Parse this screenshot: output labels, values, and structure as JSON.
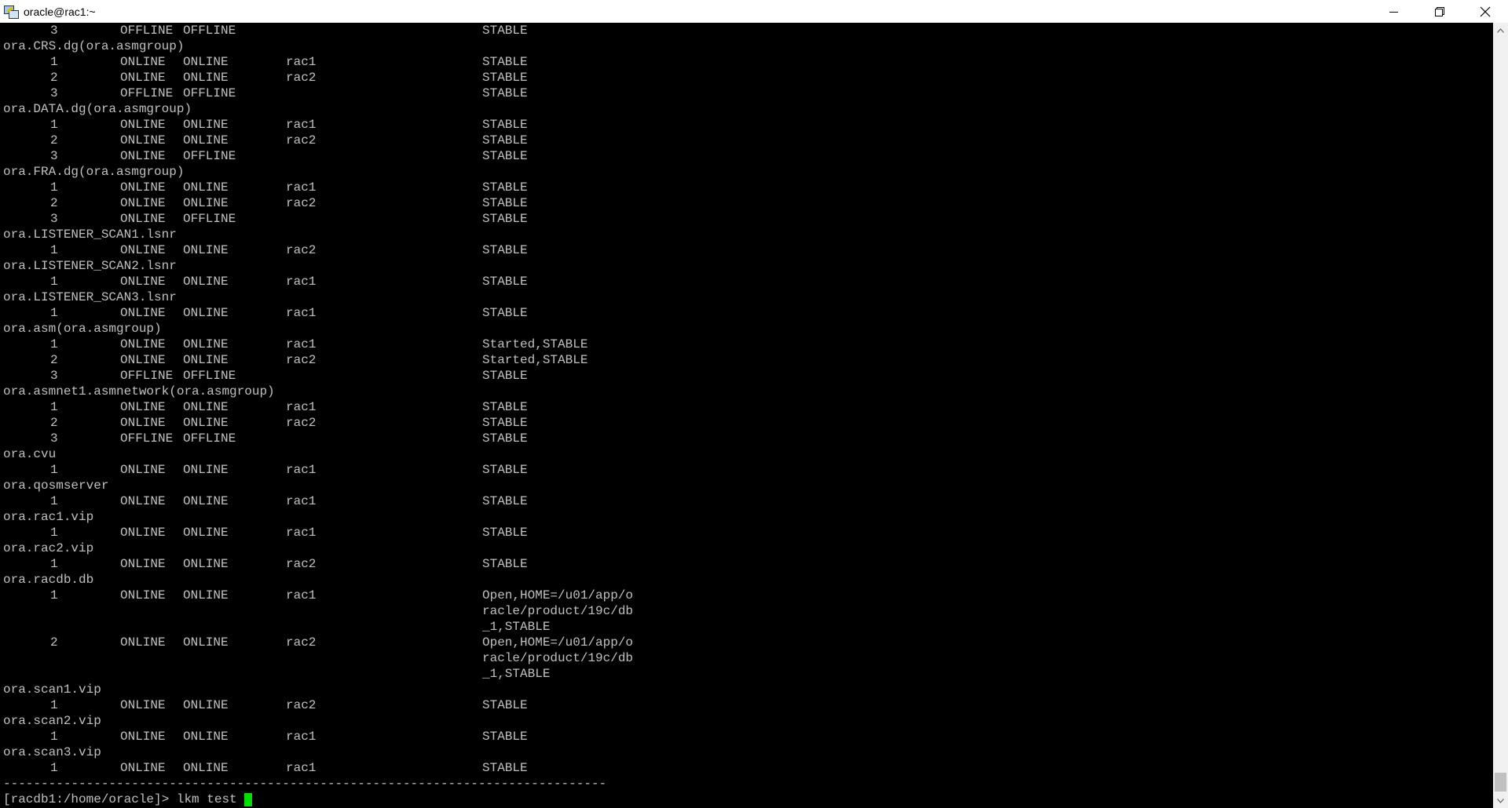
{
  "window": {
    "title": "oracle@rac1:~",
    "controls": [
      "minimize",
      "restore",
      "close"
    ]
  },
  "terminal": {
    "lines": [
      {
        "num": "3",
        "target": "OFFLINE",
        "state": "OFFLINE",
        "server": "",
        "details": "STABLE"
      },
      {
        "name": "ora.CRS.dg(ora.asmgroup)"
      },
      {
        "num": "1",
        "target": "ONLINE",
        "state": "ONLINE",
        "server": "rac1",
        "details": "STABLE"
      },
      {
        "num": "2",
        "target": "ONLINE",
        "state": "ONLINE",
        "server": "rac2",
        "details": "STABLE"
      },
      {
        "num": "3",
        "target": "OFFLINE",
        "state": "OFFLINE",
        "server": "",
        "details": "STABLE"
      },
      {
        "name": "ora.DATA.dg(ora.asmgroup)"
      },
      {
        "num": "1",
        "target": "ONLINE",
        "state": "ONLINE",
        "server": "rac1",
        "details": "STABLE"
      },
      {
        "num": "2",
        "target": "ONLINE",
        "state": "ONLINE",
        "server": "rac2",
        "details": "STABLE"
      },
      {
        "num": "3",
        "target": "ONLINE",
        "state": "OFFLINE",
        "server": "",
        "details": "STABLE"
      },
      {
        "name": "ora.FRA.dg(ora.asmgroup)"
      },
      {
        "num": "1",
        "target": "ONLINE",
        "state": "ONLINE",
        "server": "rac1",
        "details": "STABLE"
      },
      {
        "num": "2",
        "target": "ONLINE",
        "state": "ONLINE",
        "server": "rac2",
        "details": "STABLE"
      },
      {
        "num": "3",
        "target": "ONLINE",
        "state": "OFFLINE",
        "server": "",
        "details": "STABLE"
      },
      {
        "name": "ora.LISTENER_SCAN1.lsnr"
      },
      {
        "num": "1",
        "target": "ONLINE",
        "state": "ONLINE",
        "server": "rac2",
        "details": "STABLE"
      },
      {
        "name": "ora.LISTENER_SCAN2.lsnr"
      },
      {
        "num": "1",
        "target": "ONLINE",
        "state": "ONLINE",
        "server": "rac1",
        "details": "STABLE"
      },
      {
        "name": "ora.LISTENER_SCAN3.lsnr"
      },
      {
        "num": "1",
        "target": "ONLINE",
        "state": "ONLINE",
        "server": "rac1",
        "details": "STABLE"
      },
      {
        "name": "ora.asm(ora.asmgroup)"
      },
      {
        "num": "1",
        "target": "ONLINE",
        "state": "ONLINE",
        "server": "rac1",
        "details": "Started,STABLE"
      },
      {
        "num": "2",
        "target": "ONLINE",
        "state": "ONLINE",
        "server": "rac2",
        "details": "Started,STABLE"
      },
      {
        "num": "3",
        "target": "OFFLINE",
        "state": "OFFLINE",
        "server": "",
        "details": "STABLE"
      },
      {
        "name": "ora.asmnet1.asmnetwork(ora.asmgroup)"
      },
      {
        "num": "1",
        "target": "ONLINE",
        "state": "ONLINE",
        "server": "rac1",
        "details": "STABLE"
      },
      {
        "num": "2",
        "target": "ONLINE",
        "state": "ONLINE",
        "server": "rac2",
        "details": "STABLE"
      },
      {
        "num": "3",
        "target": "OFFLINE",
        "state": "OFFLINE",
        "server": "",
        "details": "STABLE"
      },
      {
        "name": "ora.cvu"
      },
      {
        "num": "1",
        "target": "ONLINE",
        "state": "ONLINE",
        "server": "rac1",
        "details": "STABLE"
      },
      {
        "name": "ora.qosmserver"
      },
      {
        "num": "1",
        "target": "ONLINE",
        "state": "ONLINE",
        "server": "rac1",
        "details": "STABLE"
      },
      {
        "name": "ora.rac1.vip"
      },
      {
        "num": "1",
        "target": "ONLINE",
        "state": "ONLINE",
        "server": "rac1",
        "details": "STABLE"
      },
      {
        "name": "ora.rac2.vip"
      },
      {
        "num": "1",
        "target": "ONLINE",
        "state": "ONLINE",
        "server": "rac2",
        "details": "STABLE"
      },
      {
        "name": "ora.racdb.db"
      },
      {
        "num": "1",
        "target": "ONLINE",
        "state": "ONLINE",
        "server": "rac1",
        "details": "Open,HOME=/u01/app/o"
      },
      {
        "details": "racle/product/19c/db"
      },
      {
        "details": "_1,STABLE"
      },
      {
        "num": "2",
        "target": "ONLINE",
        "state": "ONLINE",
        "server": "rac2",
        "details": "Open,HOME=/u01/app/o"
      },
      {
        "details": "racle/product/19c/db"
      },
      {
        "details": "_1,STABLE"
      },
      {
        "name": "ora.scan1.vip"
      },
      {
        "num": "1",
        "target": "ONLINE",
        "state": "ONLINE",
        "server": "rac2",
        "details": "STABLE"
      },
      {
        "name": "ora.scan2.vip"
      },
      {
        "num": "1",
        "target": "ONLINE",
        "state": "ONLINE",
        "server": "rac1",
        "details": "STABLE"
      },
      {
        "name": "ora.scan3.vip"
      },
      {
        "num": "1",
        "target": "ONLINE",
        "state": "ONLINE",
        "server": "rac1",
        "details": "STABLE"
      },
      {
        "separator": "--------------------------------------------------------------------------------"
      },
      {
        "prompt": "[racdb1:/home/oracle]> lkm test "
      }
    ]
  },
  "colors": {
    "background": "#000000",
    "text": "#c0c0c0",
    "cursor": "#00e000",
    "titlebar": "#ffffff"
  }
}
